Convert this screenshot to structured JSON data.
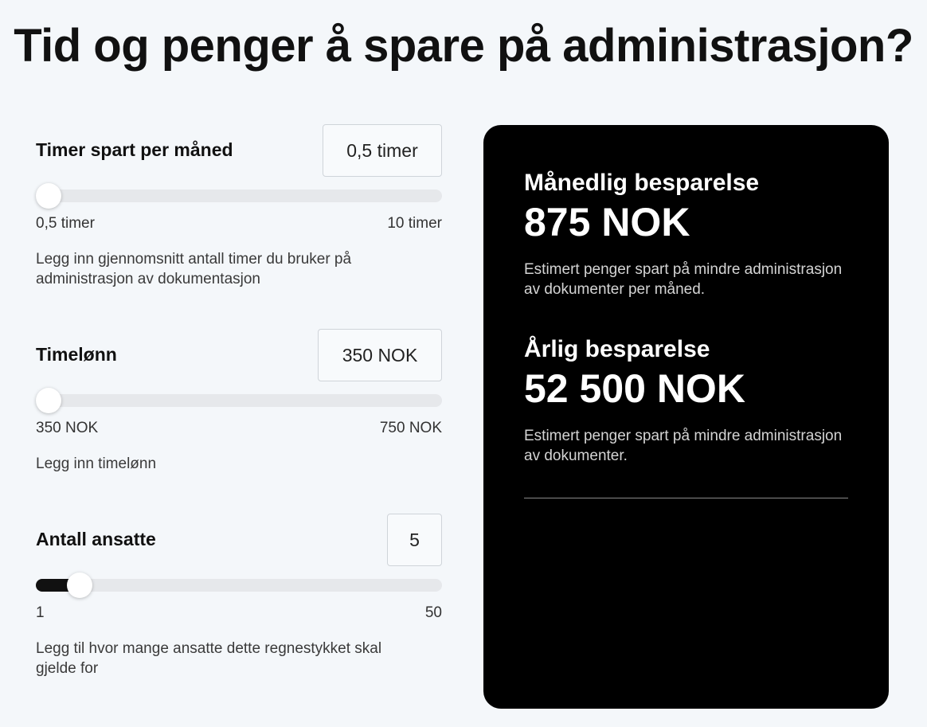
{
  "page": {
    "title": "Tid og penger å spare på administrasjon?"
  },
  "fields": [
    {
      "label": "Timer spart per måned",
      "value": "0,5 timer",
      "min_label": "0,5 timer",
      "max_label": "10 timer",
      "help": "Legg inn gjennomsnitt antall timer du bruker på administrasjon av dokumentasjon",
      "slider": {
        "min": 0.5,
        "max": 10,
        "current": 0.5
      }
    },
    {
      "label": "Timelønn",
      "value": "350 NOK",
      "min_label": "350 NOK",
      "max_label": "750 NOK",
      "help": "Legg inn timelønn",
      "slider": {
        "min": 350,
        "max": 750,
        "current": 350
      }
    },
    {
      "label": "Antall ansatte",
      "value": "5",
      "min_label": "1",
      "max_label": "50",
      "help": "Legg til hvor mange ansatte dette regnestykket skal gjelde for",
      "slider": {
        "min": 1,
        "max": 50,
        "current": 5
      }
    }
  ],
  "results": {
    "monthly": {
      "heading": "Månedlig besparelse",
      "amount": "875 NOK",
      "note": "Estimert penger spart på mindre administrasjon av dokumenter per måned."
    },
    "yearly": {
      "heading": "Årlig besparelse",
      "amount": "52 500 NOK",
      "note": "Estimert penger spart på mindre administrasjon av dokumenter."
    }
  },
  "colors": {
    "background": "#f4f7fa",
    "card": "#000000",
    "slider_track": "#e6e8eb",
    "slider_fill": "#111111"
  }
}
